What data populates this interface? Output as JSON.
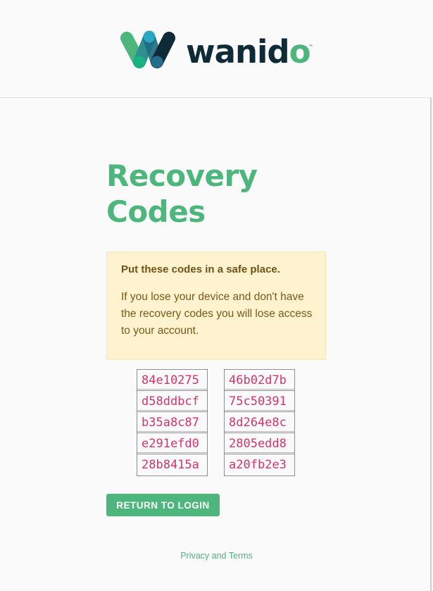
{
  "brand": {
    "name_main": "wanid",
    "name_last": "o",
    "trademark": "™",
    "logo_icon": "wanido-w-logo-icon"
  },
  "page": {
    "title": "Recovery Codes"
  },
  "alert": {
    "title": "Put these codes in a safe place.",
    "body": "If you lose your device and don't have the recovery codes you will lose access to your account."
  },
  "codes": {
    "left": [
      "84e10275",
      "d58ddbcf",
      "b35a8c87",
      "e291efd0",
      "28b8415a"
    ],
    "right": [
      "46b02d7b",
      "75c50391",
      "8d264e8c",
      "2805edd8",
      "a20fb2e3"
    ]
  },
  "actions": {
    "return_label": "RETURN TO LOGIN"
  },
  "footer": {
    "link_label": "Privacy and Terms"
  },
  "colors": {
    "brand_green": "#4db67c",
    "brand_navy": "#0f2b38",
    "alert_bg": "#fff2cf",
    "code_text": "#d6336c"
  }
}
